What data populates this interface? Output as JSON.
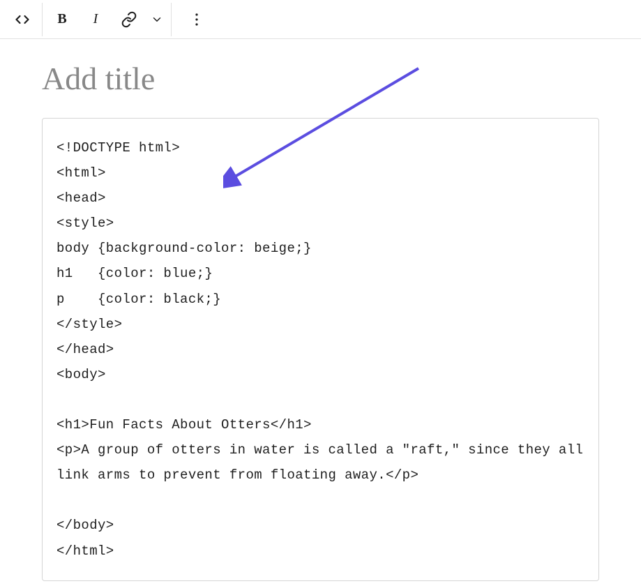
{
  "toolbar": {
    "html_button_tooltip": "HTML",
    "bold_label": "B",
    "italic_label": "I",
    "link_tooltip": "Link",
    "dropdown_tooltip": "More rich text controls",
    "more_tooltip": "More options"
  },
  "title": {
    "placeholder": "Add title",
    "value": ""
  },
  "code_block": {
    "content": "<!DOCTYPE html>\n<html>\n<head>\n<style>\nbody {background-color: beige;}\nh1   {color: blue;}\np    {color: black;}\n</style>\n</head>\n<body>\n\n<h1>Fun Facts About Otters</h1>\n<p>A group of otters in water is called a \"raft,\" since they all link arms to prevent from floating away.</p>\n\n</body>\n</html>"
  },
  "annotation": {
    "color": "#5b4de0"
  }
}
